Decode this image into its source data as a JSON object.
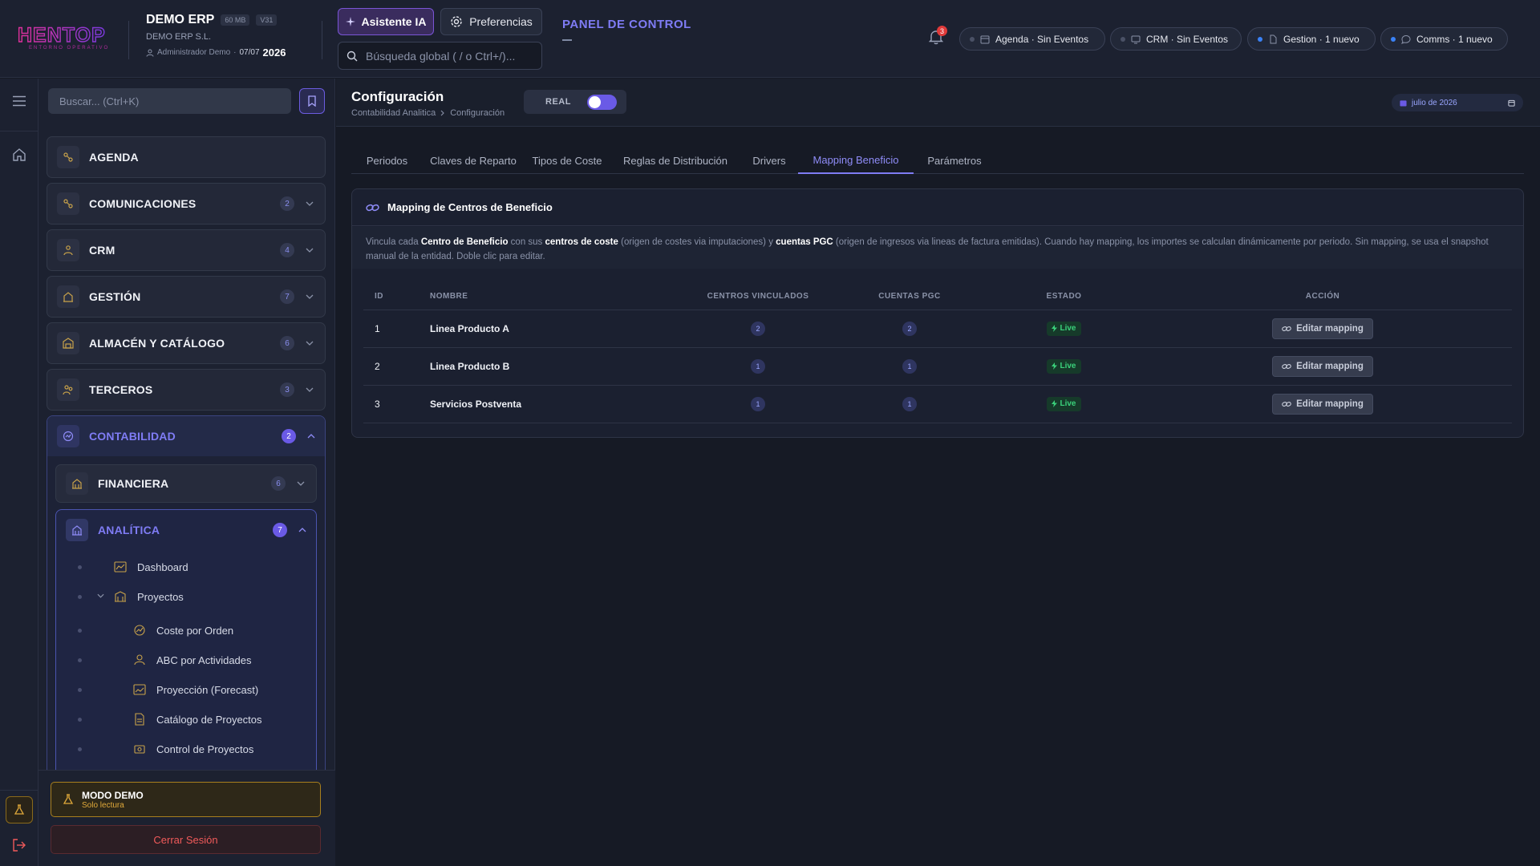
{
  "brand": {
    "logo_text": "HENTOP",
    "logo_subtitle": "ENTORNO OPERATIVO"
  },
  "company": {
    "name": "DEMO ERP",
    "size_chip": "60 MB",
    "version_chip": "V31",
    "legal_name": "DEMO ERP S.L.",
    "user": "Administrador Demo",
    "date": "07/07",
    "year": "2026"
  },
  "header": {
    "ai_button": "Asistente IA",
    "preferences_button": "Preferencias",
    "search_placeholder": "Búsqueda global ( / o Ctrl+/)...",
    "panel_title": "PANEL DE CONTROL",
    "notification_count": "3"
  },
  "status_pills": [
    {
      "label": "Agenda · Sin Eventos",
      "icon": "calendar-icon"
    },
    {
      "label": "CRM · Sin Eventos",
      "icon": "crm-icon"
    },
    {
      "label": "Gestion · 1 nuevo",
      "icon": "document-icon"
    },
    {
      "label": "Comms · 1 nuevo",
      "icon": "chat-icon"
    }
  ],
  "sidebar": {
    "search_placeholder": "Buscar... (Ctrl+K)",
    "items": [
      {
        "label": "AGENDA",
        "badge": ""
      },
      {
        "label": "COMUNICACIONES",
        "badge": "2"
      },
      {
        "label": "CRM",
        "badge": "4"
      },
      {
        "label": "GESTIÓN",
        "badge": "7"
      },
      {
        "label": "ALMACÉN Y CATÁLOGO",
        "badge": "6"
      },
      {
        "label": "TERCEROS",
        "badge": "3"
      }
    ],
    "contabilidad": {
      "label": "CONTABILIDAD",
      "badge": "2"
    },
    "financiera": {
      "label": "FINANCIERA",
      "badge": "6"
    },
    "analitica": {
      "label": "ANALÍTICA",
      "badge": "7"
    },
    "analitica_items": [
      "Dashboard",
      "Proyectos",
      "Coste por Orden",
      "ABC por Actividades",
      "Proyección (Forecast)",
      "Catálogo de Proyectos",
      "Control de Proyectos"
    ],
    "demo_title": "MODO DEMO",
    "demo_sub": "Solo lectura",
    "logout": "Cerrar Sesión"
  },
  "page": {
    "title": "Configuración",
    "breadcrumb": [
      "Contabilidad Analitica",
      "Configuración"
    ],
    "mode_label": "REAL",
    "date_label": "julio de 2026",
    "tabs": [
      "Periodos",
      "Claves de Reparto",
      "Tipos de Coste",
      "Reglas de Distribución",
      "Drivers",
      "Mapping Beneficio",
      "Parámetros"
    ],
    "active_tab": "Mapping Beneficio"
  },
  "card": {
    "title": "Mapping de Centros de Beneficio",
    "desc": {
      "p1": "Vincula cada ",
      "b1": "Centro de Beneficio",
      "p2": " con sus ",
      "b2": "centros de coste",
      "p3": " (origen de costes via imputaciones) y ",
      "b3": "cuentas PGC",
      "p4": " (origen de ingresos via lineas de factura emitidas). Cuando hay mapping, los importes se calculan dinámicamente por periodo. Sin mapping, se usa el snapshot manual de la entidad. Doble clic para editar."
    },
    "columns": [
      "ID",
      "NOMBRE",
      "CENTROS VINCULADOS",
      "CUENTAS PGC",
      "ESTADO",
      "ACCIÓN"
    ],
    "rows": [
      {
        "id": "1",
        "name": "Linea Producto A",
        "centros": "2",
        "cuentas": "2",
        "estado": "Live",
        "accion": "Editar mapping"
      },
      {
        "id": "2",
        "name": "Linea Producto B",
        "centros": "1",
        "cuentas": "1",
        "estado": "Live",
        "accion": "Editar mapping"
      },
      {
        "id": "3",
        "name": "Servicios Postventa",
        "centros": "1",
        "cuentas": "1",
        "estado": "Live",
        "accion": "Editar mapping"
      }
    ]
  },
  "colors": {
    "accent": "#7f7cf5",
    "brand": "#e0309a",
    "live": "#3ad07a",
    "demo": "#e0a93a",
    "danger": "#f05a5a"
  }
}
